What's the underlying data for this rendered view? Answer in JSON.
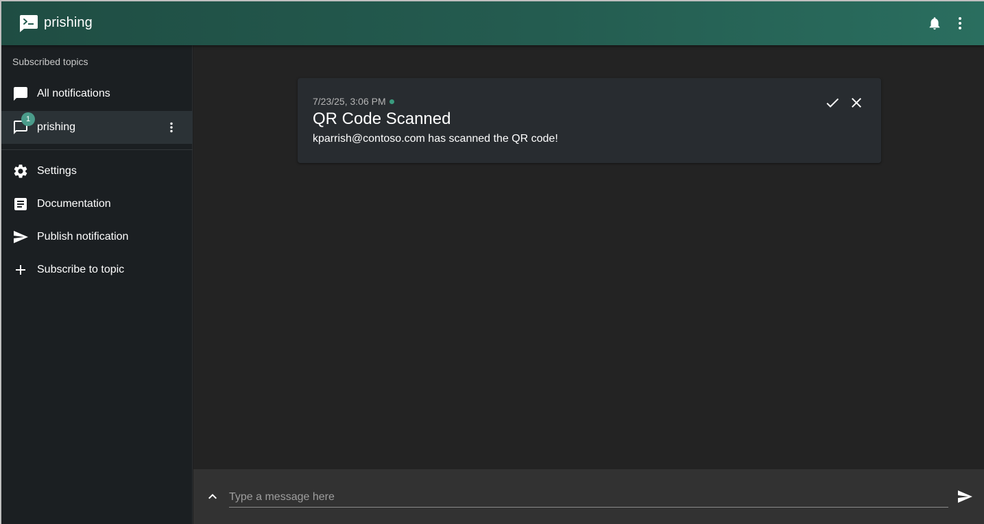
{
  "app": {
    "title": "prishing",
    "accent_color": "#2a6e5f",
    "icons": {
      "logo": "terminal-message-icon",
      "bell": "bell-icon",
      "more": "more-vert-icon"
    }
  },
  "sidebar": {
    "section_label": "Subscribed topics",
    "topics": [
      {
        "label": "All notifications",
        "icon": "chat-icon"
      },
      {
        "label": "prishing",
        "icon": "chat-outline-icon",
        "badge": "1",
        "selected": true
      }
    ],
    "menu": [
      {
        "label": "Settings",
        "icon": "gear-icon"
      },
      {
        "label": "Documentation",
        "icon": "article-icon"
      },
      {
        "label": "Publish notification",
        "icon": "send-icon"
      },
      {
        "label": "Subscribe to topic",
        "icon": "plus-icon"
      }
    ]
  },
  "notification": {
    "date": "7/23/25, 3:06 PM",
    "title": "QR Code Scanned",
    "message": "kparrish@contoso.com has scanned the QR code!",
    "new_indicator_color": "#3a9b7e"
  },
  "composer": {
    "placeholder": "Type a message here",
    "value": ""
  }
}
